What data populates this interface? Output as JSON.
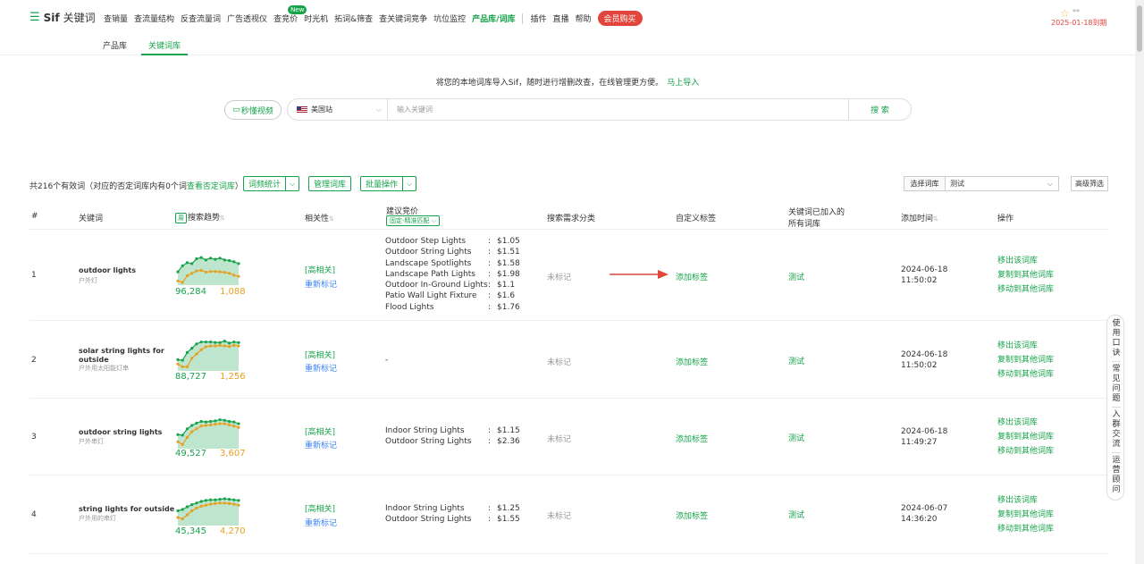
{
  "nav": {
    "brand_logo": "☰",
    "brand_name": "Sif",
    "brand_sub": "关键词",
    "items": [
      {
        "label": "查销量"
      },
      {
        "label": "查流量结构"
      },
      {
        "label": "反查流量词"
      },
      {
        "label": "广告透视仪"
      },
      {
        "label": "查竞价",
        "badge": "New"
      },
      {
        "label": "时光机"
      },
      {
        "label": "拓词&筛查"
      },
      {
        "label": "查关键词竞争"
      },
      {
        "label": "坑位监控"
      },
      {
        "label": "产品库/词库",
        "active": true
      }
    ],
    "items2": [
      {
        "label": "插件"
      },
      {
        "label": "直播"
      },
      {
        "label": "帮助"
      }
    ],
    "vip_label": "会员购买",
    "user_name": "**",
    "expire_text": "2025-01-18到期"
  },
  "subnav": {
    "tabs": [
      {
        "label": "产品库",
        "active": false
      },
      {
        "label": "关键词库",
        "active": true
      }
    ]
  },
  "import": {
    "text": "将您的本地词库导入Sif，随时进行增删改查，在线管理更方便。",
    "link": "马上导入"
  },
  "search": {
    "video_label": "秒懂视频",
    "site": "美国站",
    "placeholder": "输入关键词",
    "button": "搜 索"
  },
  "toolbar": {
    "summary_prefix": "共216个有效词（对应的否定词库内有0个词",
    "summary_link": "查看否定词库",
    "summary_suffix": "）",
    "btn_stats": "词频统计",
    "btn_manage": "管理词库",
    "btn_batch": "批量操作",
    "lib_label": "选择词库",
    "lib_value": "测试",
    "adv_filter": "高级筛选"
  },
  "table": {
    "headers": {
      "index": "#",
      "keyword": "关键词",
      "trend_sel": "周",
      "trend": "搜索趋势",
      "relevance": "相关性",
      "bid": "建议竞价",
      "bid_match": "固定-精准匹配",
      "demand": "搜索需求分类",
      "tag": "自定义标签",
      "libs_1": "关键词已加入的",
      "libs_2": "所有词库",
      "added": "添加时间",
      "ops": "操作"
    },
    "rows": [
      {
        "index": "1",
        "keyword": "outdoor lights",
        "keyword_zh": "户外灯",
        "vol_a": "96,284",
        "vol_b": "1,088",
        "trend_a": [
          0.35,
          0.55,
          0.65,
          0.62,
          0.78,
          0.82,
          0.74,
          0.8,
          0.76,
          0.8,
          0.74,
          0.72,
          0.68,
          0.62
        ],
        "trend_b": [
          0.05,
          0.0,
          0.22,
          0.3,
          0.38,
          0.4,
          0.34,
          0.36,
          0.36,
          0.35,
          0.33,
          0.3,
          0.24,
          0.2
        ],
        "relevance": "[高相关]",
        "remark": "重新标记",
        "bids": [
          {
            "name": "Outdoor Step Lights",
            "price": "$1.05"
          },
          {
            "name": "Outdoor String Lights",
            "price": "$1.51"
          },
          {
            "name": "Landscape Spotlights",
            "price": "$1.58"
          },
          {
            "name": "Landscape Path Lights",
            "price": "$1.98"
          },
          {
            "name": "Outdoor In-Ground Lights",
            "price": "$1.1"
          },
          {
            "name": "Patio Wall Light Fixture",
            "price": "$1.6"
          },
          {
            "name": "Flood Lights",
            "price": "$1.76"
          }
        ],
        "status": "未标记",
        "tag": "添加标签",
        "lib": "测试",
        "date": "2024-06-18",
        "time": "11:50:02",
        "op1": "移出该词库",
        "op2": "复制到其他词库",
        "op3": "移动到其他词库"
      },
      {
        "index": "2",
        "keyword": "solar string lights for outside",
        "keyword_zh": "户外用太阳能灯串",
        "vol_a": "88,727",
        "vol_b": "1,256",
        "trend_a": [
          0.3,
          0.28,
          0.55,
          0.7,
          0.85,
          0.92,
          0.92,
          0.92,
          0.9,
          0.9,
          0.95,
          0.88,
          0.92,
          0.9
        ],
        "trend_b": [
          0.15,
          0.05,
          0.05,
          0.35,
          0.5,
          0.65,
          0.75,
          0.78,
          0.78,
          0.8,
          0.78,
          0.76,
          0.8,
          0.78
        ],
        "relevance": "[高相关]",
        "remark": "重新标记",
        "bids_dash": "-",
        "status": "未标记",
        "tag": "添加标签",
        "lib": "测试",
        "date": "2024-06-18",
        "time": "11:50:02",
        "op1": "移出该词库",
        "op2": "复制到其他词库",
        "op3": "移动到其他词库"
      },
      {
        "index": "3",
        "keyword": "outdoor string lights",
        "keyword_zh": "户外串灯",
        "vol_a": "49,527",
        "vol_b": "3,607",
        "trend_a": [
          0.4,
          0.38,
          0.6,
          0.72,
          0.8,
          0.86,
          0.84,
          0.86,
          0.88,
          0.92,
          0.9,
          0.86,
          0.84,
          0.78
        ],
        "trend_b": [
          0.15,
          0.05,
          0.3,
          0.5,
          0.6,
          0.7,
          0.72,
          0.74,
          0.76,
          0.78,
          0.78,
          0.74,
          0.7,
          0.65
        ],
        "relevance": "[高相关]",
        "remark": "重新标记",
        "bids": [
          {
            "name": "Indoor String Lights",
            "price": "$1.15"
          },
          {
            "name": "Outdoor String Lights",
            "price": "$2.36"
          }
        ],
        "status": "未标记",
        "tag": "添加标签",
        "lib": "测试",
        "date": "2024-06-18",
        "time": "11:49:27",
        "op1": "移出该词库",
        "op2": "复制到其他词库",
        "op3": "移动到其他词库"
      },
      {
        "index": "4",
        "keyword": "string lights for outside",
        "keyword_zh": "户外用的串灯",
        "vol_a": "45,345",
        "vol_b": "4,270",
        "trend_a": [
          0.45,
          0.5,
          0.6,
          0.68,
          0.74,
          0.8,
          0.84,
          0.86,
          0.86,
          0.88,
          0.9,
          0.88,
          0.86,
          0.84
        ],
        "trend_b": [
          0.2,
          0.15,
          0.3,
          0.45,
          0.55,
          0.62,
          0.66,
          0.7,
          0.72,
          0.74,
          0.74,
          0.72,
          0.7,
          0.66
        ],
        "relevance": "[高相关]",
        "remark": "重新标记",
        "bids": [
          {
            "name": "Indoor String Lights",
            "price": "$1.25"
          },
          {
            "name": "Outdoor String Lights",
            "price": "$1.55"
          }
        ],
        "status": "未标记",
        "tag": "添加标签",
        "lib": "测试",
        "date": "2024-06-07",
        "time": "14:36:20",
        "op1": "移出该词库",
        "op2": "复制到其他词库",
        "op3": "移动到其他词库"
      }
    ]
  },
  "float": {
    "items": [
      "使用口诀",
      "常见问题",
      "入群交流",
      "运营顾问"
    ]
  },
  "colors": {
    "accent": "#16a34a",
    "orange": "#e8a022",
    "red": "#e1453c",
    "blue": "#3b82f6"
  }
}
